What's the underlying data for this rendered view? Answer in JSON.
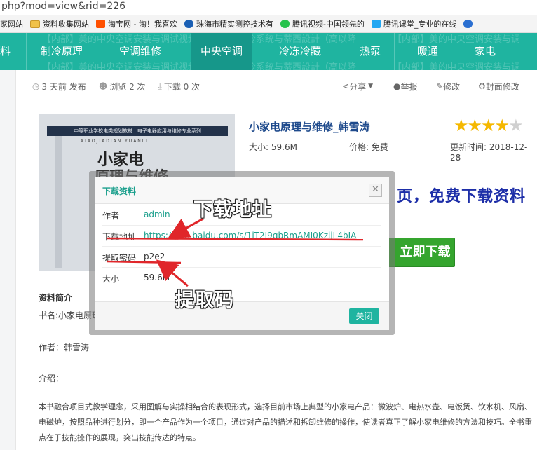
{
  "url": "php?mod=view&rid=226",
  "bookmarks": [
    {
      "label": "家网站",
      "color": "#3a7bd5"
    },
    {
      "label": "资料收集网站",
      "folder": true
    },
    {
      "label": "淘宝网 - 淘！我喜欢",
      "color": "#ff5000"
    },
    {
      "label": "珠海市精实测控技术有",
      "color": "#1a5fb4"
    },
    {
      "label": "腾讯视频-中国领先的",
      "color": "#27c24c"
    },
    {
      "label": "腾讯课堂_专业的在线",
      "color": "#23a7f2"
    }
  ],
  "nav": {
    "items": [
      "料",
      "制冷原理",
      "空调维修",
      "中央空调",
      "冷冻冷藏",
      "热泵",
      "暖通",
      "家电"
    ],
    "active": "中央空调",
    "ghost_text": [
      "【内部】美的中央空调安装与调试视频",
      "《吉美制冷系统与蒂西設計（高以降",
      "【内部】美的中央空调安装与调"
    ]
  },
  "meta": {
    "published": "3 天前 发布",
    "views": "浏览 2 次",
    "downloads": "下载 0 次",
    "share": "分享",
    "report": "举报",
    "edit": "修改",
    "cover_edit": "封面修改"
  },
  "product": {
    "title": "小家电原理与维修_韩雪涛",
    "size": "大小: 59.6M",
    "price": "价格: 免费",
    "updated": "更新时间: 2018-12-28",
    "rating": 4,
    "banner": "页，免费下载资料",
    "download_button": "立即下载",
    "cover_top": "中等职业学校电类规划教材 · 电子电器应用与维修专业系列",
    "cover_sub": "XIAOJIADIAN YUANLI",
    "cover_title_1": "小家电",
    "cover_title_2": "原理与维修"
  },
  "description": {
    "heading": "资料简介",
    "book": "书名:小家电原理",
    "author": "作者：韩雪涛",
    "intro": "介绍：",
    "body": "本书融合项目式教学理念，采用图解与实操相结合的表现形式，选择目前市场上典型的小家电产品：微波炉、电热水壶、电饭煲、饮水机、风扇、电磁炉，按照品种进行划分，即一个产品作为一个项目，通过对产品的描述和拆卸维修的操作，使读者真正了解小家电维修的方法和技巧。全书重点在于技能操作的展现，突出技能传达的特点。"
  },
  "modal": {
    "title": "下载资料",
    "close_symbol": "✕",
    "rows": [
      {
        "label": "作者",
        "value": "admin"
      },
      {
        "label": "下载地址",
        "value": "https://pan.baidu.com/s/1iT2I9qbRmAMI0KzijL4bIA"
      },
      {
        "label": "提取密码",
        "value": "p2e2"
      },
      {
        "label": "大小",
        "value": "59.6M"
      }
    ],
    "ok": "关闭"
  },
  "annotations": {
    "address": "下载地址",
    "code": "提取码",
    "color": "#e0262a"
  }
}
